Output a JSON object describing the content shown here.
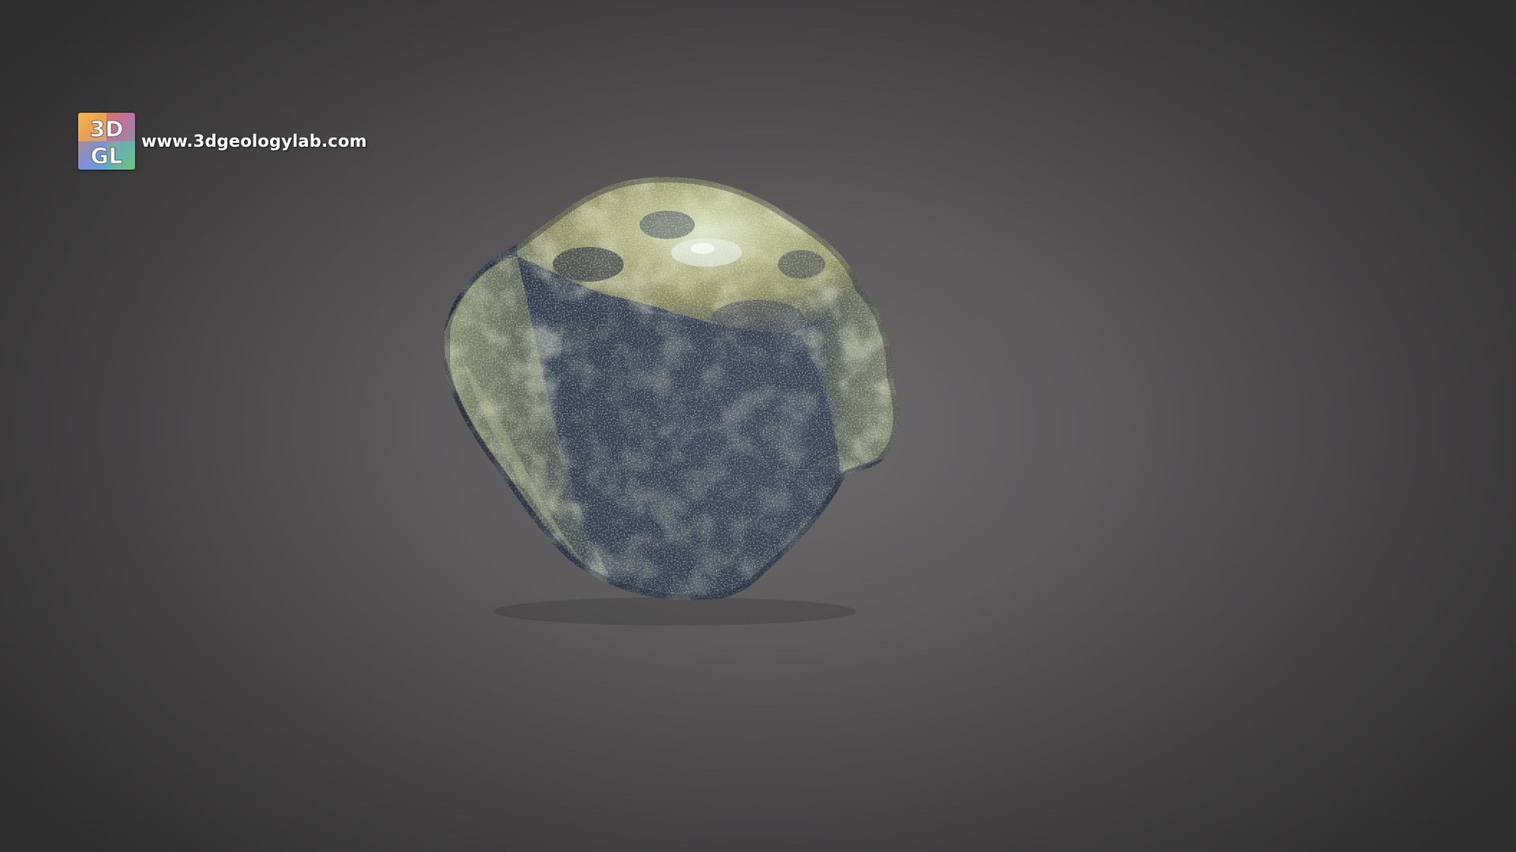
{
  "watermark": {
    "logo_text_top": "3D",
    "logo_text_bottom": "GL",
    "url": "www.3dgeologylab.com",
    "logo_colors": [
      "#e8a04a",
      "#d46b6b",
      "#8a6fc2",
      "#5aa3d6",
      "#6cc070",
      "#e6d25a"
    ]
  },
  "viewer": {
    "background": "#5c5a5b",
    "model": "rock-specimen"
  }
}
